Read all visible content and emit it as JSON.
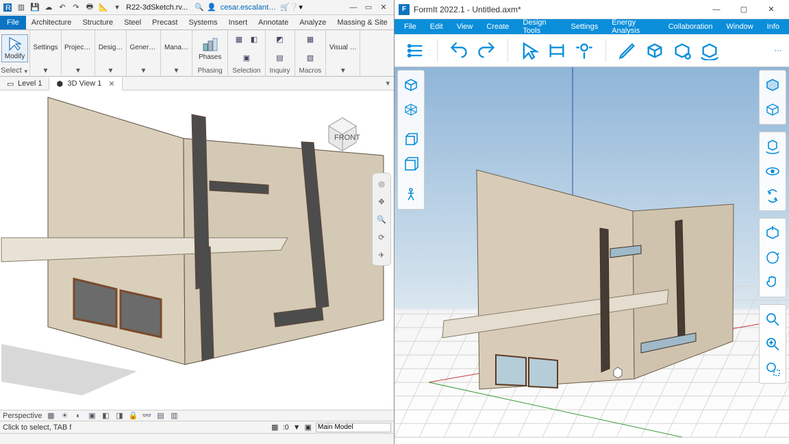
{
  "revit": {
    "qat_icons": [
      "app",
      "open",
      "save",
      "sync",
      "undo",
      "redo",
      "print",
      "measure",
      "home"
    ],
    "doc_title": "R22-3dSketch.rv...",
    "user": "cesar.escalant…",
    "tabs": [
      "Architecture",
      "Structure",
      "Steel",
      "Precast",
      "Systems",
      "Insert",
      "Annotate",
      "Analyze",
      "Massing & Site"
    ],
    "file_tab": "File",
    "ribbon": {
      "modify": "Modify",
      "select": "Select",
      "groups": [
        "Settings",
        "Project…",
        "Desig…",
        "Generati…",
        "Mana…",
        "Visual Pr…"
      ],
      "phases": "Phases",
      "panels_bottom": [
        "Phasing",
        "Selection",
        "Inquiry",
        "Macros"
      ]
    },
    "view_tabs": {
      "level1": "Level 1",
      "view3d": "3D View 1"
    },
    "viewcube_label": "FRONT",
    "perspective": "Perspective",
    "status_hint": "Click to select, TAB for a",
    "sel_zero": ":0",
    "main_model": "Main Model"
  },
  "formit": {
    "title": "FormIt 2022.1 - Untitled.axm*",
    "logo": "F",
    "menus": [
      "File",
      "Edit",
      "View",
      "Create",
      "Design Tools",
      "Settings",
      "Energy Analysis",
      "Collaboration",
      "Window",
      "Info"
    ],
    "tool_icons": [
      "properties-list",
      "undo",
      "redo",
      "select-arrow",
      "section",
      "sun",
      "pencil",
      "cube-plus",
      "cube-array",
      "cube-turn"
    ],
    "left_palette": [
      "navcube",
      "wireframe",
      "box-perspective",
      "box-ortho",
      "walk"
    ],
    "right_palette": {
      "g1": [
        "top-view",
        "3d-view"
      ],
      "g2": [
        "orbit",
        "look",
        "swivel"
      ],
      "g3": [
        "pan",
        "hand-rotate",
        "hand"
      ],
      "g4": [
        "zoom",
        "zoom-fit",
        "zoom-selection"
      ]
    }
  }
}
